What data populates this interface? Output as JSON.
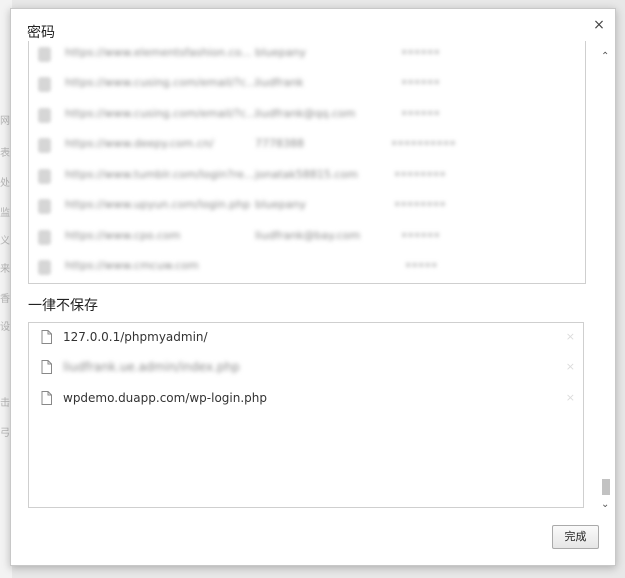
{
  "dialog": {
    "title": "密码",
    "close_glyph": "×"
  },
  "saved_passwords": [
    {
      "site": "https://www.elementsfashion.co...",
      "user": "bluepany",
      "pass": "••••••"
    },
    {
      "site": "https://www.cusing.com/email/?c...",
      "user": "liudfrank",
      "pass": "••••••"
    },
    {
      "site": "https://www.cusing.com/email/?c...",
      "user": "liudfrank@qq.com",
      "pass": "••••••"
    },
    {
      "site": "https://www.deepy.com.cn/",
      "user": "7778388",
      "pass": "••••••••••"
    },
    {
      "site": "https://www.tumblr.com/login?re...",
      "user": "jonatak58815.com",
      "pass": "••••••••"
    },
    {
      "site": "https://www.upyun.com/login.php",
      "user": "bluepany",
      "pass": "••••••••"
    },
    {
      "site": "https://www.cpo.com",
      "user": "liudfrank@bay.com",
      "pass": "••••••"
    },
    {
      "site": "https://www.cmcuw.com",
      "user": "",
      "pass": "•••••"
    }
  ],
  "never_saved": {
    "label": "一律不保存",
    "items": [
      {
        "url": "127.0.0.1/phpmyadmin/",
        "blurred": false
      },
      {
        "url": "liudfrank.ue.admin/index.php",
        "blurred": true
      },
      {
        "url": "wpdemo.duapp.com/wp-login.php",
        "blurred": false
      }
    ],
    "remove_glyph": "×"
  },
  "scrollbar": {
    "up_glyph": "⌃",
    "down_glyph": "⌄"
  },
  "done_button": "完成",
  "background_chars": [
    "网",
    "表",
    "处",
    "监",
    "义",
    "来",
    "香",
    "设",
    "击",
    "弓"
  ]
}
